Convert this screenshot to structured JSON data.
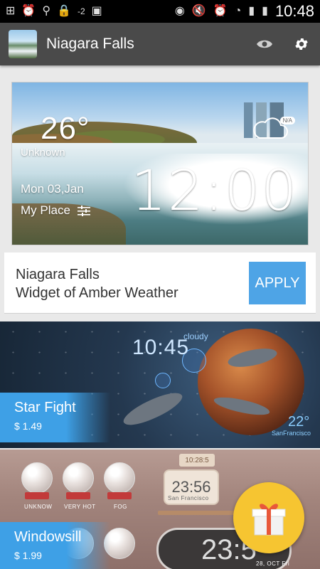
{
  "status_bar": {
    "time": "10:48",
    "signal_badge": "-2",
    "icons_left": [
      "add-box-icon",
      "alarm-icon",
      "usb-icon",
      "lock-icon",
      "signal-icon",
      "image-icon"
    ],
    "icons_right": [
      "eye-icon",
      "mute-icon",
      "alarm-icon",
      "wifi-icon",
      "signal-bars-icon",
      "battery-icon"
    ]
  },
  "app_bar": {
    "title": "Niagara Falls",
    "actions": [
      "eye-icon",
      "gear-icon"
    ]
  },
  "preview": {
    "temperature": "26°",
    "condition": "Unknown",
    "date": "Mon 03,Jan",
    "place": "My Place",
    "clock": "12:00",
    "weather_badge": "N/A",
    "weather_icon": "cloud-icon"
  },
  "apply_panel": {
    "theme_name": "Niagara Falls",
    "subtitle": "Widget of Amber Weather",
    "apply_label": "APPLY"
  },
  "themes": [
    {
      "name": "Star Fight",
      "price": "$ 1.49",
      "preview_time": "10:45",
      "preview_condition": "cloudy",
      "preview_temp": "22°",
      "preview_city": "SanFrancisco"
    },
    {
      "name": "Windowsill",
      "price": "$ 1.99",
      "preview_top_clock": "10:28:5",
      "preview_clock": "23:56",
      "preview_big_clock": "23:5",
      "preview_small_label": "San Francisco",
      "preview_date": "28, OCT Fri",
      "globe_labels": [
        "UNKNOW",
        "VERY HOT",
        "FOG"
      ]
    }
  ],
  "gift_button_icon": "gift-icon"
}
